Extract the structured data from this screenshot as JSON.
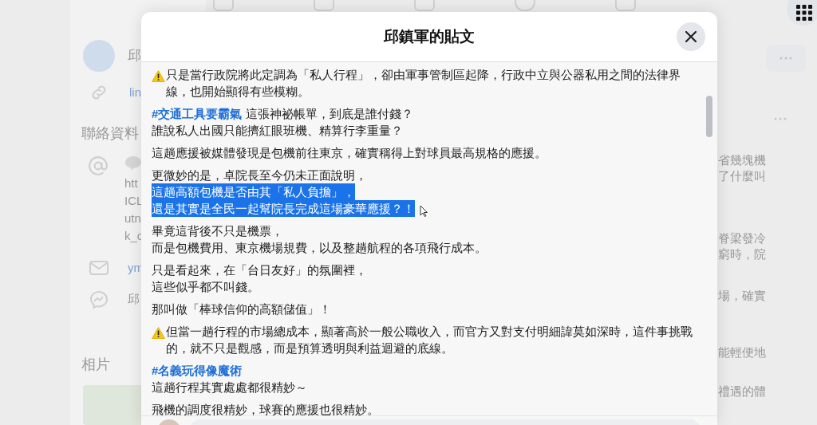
{
  "background": {
    "profile_name": "邱",
    "link": "lin",
    "contact_heading": "聯絡資料",
    "contact_lines": [
      "htt",
      "ICL",
      "utn",
      "k_c"
    ],
    "email": "ym",
    "messenger": "邱",
    "photos_heading": "相片",
    "side_fragments": [
      [
        "省幾塊機",
        "了什麼叫"
      ],
      [
        "脊梁發冷",
        "窮時，院"
      ],
      [
        "場，確實"
      ],
      [
        "能輕便地"
      ],
      [
        "禮遇的體"
      ]
    ]
  },
  "modal": {
    "title": "邱鎮軍的貼文",
    "paragraphs": [
      {
        "warning": true,
        "lines": [
          {
            "text": "只是當行政院將此定調為「私人行程」，卻由軍事管制區起降，行政中立與公器私用之間的法律界線，也開始顯得有些模糊。",
            "selected": false
          }
        ]
      },
      {
        "warning": false,
        "lines": [
          {
            "hashtag": "#交通工具要霸氣",
            "text": "這張神祕帳單，到底是誰付錢？",
            "selected": false
          },
          {
            "text": "誰說私人出國只能擠紅眼班機、精算行李重量？",
            "selected": false
          }
        ]
      },
      {
        "warning": false,
        "lines": [
          {
            "text": "這趟應援被媒體發現是包機前往東京，確實稱得上對球員最高規格的應援。",
            "selected": false
          }
        ]
      },
      {
        "warning": false,
        "lines": [
          {
            "text": "更微妙的是，卓院長至今仍未正面說明，",
            "selected": false
          },
          {
            "text": "這趟高額包機是否由其「私人負擔」，",
            "selected": true
          },
          {
            "text": "還是其實是全民一起幫院長完成這場豪華應援？！",
            "selected": true
          }
        ]
      },
      {
        "warning": false,
        "lines": [
          {
            "text": "畢竟這背後不只是機票，",
            "selected": false
          },
          {
            "text": "而是包機費用、東京機場規費，以及整趟航程的各項飛行成本。",
            "selected": false
          }
        ]
      },
      {
        "warning": false,
        "lines": [
          {
            "text": "只是看起來，在「台日友好」的氛圍裡，",
            "selected": false
          },
          {
            "text": "這些似乎都不叫錢。",
            "selected": false
          }
        ]
      },
      {
        "warning": false,
        "lines": [
          {
            "text": "那叫做「棒球信仰的高額儲值」！",
            "selected": false
          }
        ]
      },
      {
        "warning": true,
        "lines": [
          {
            "text": "但當一趟行程的市場總成本，顯著高於一般公職收入，而官方又對支付明細諱莫如深時，這件事挑戰的，就不只是觀感，而是預算透明與利益迴避的底線。",
            "selected": false
          }
        ]
      },
      {
        "warning": false,
        "lines": [
          {
            "hashtag": "#名義玩得像魔術",
            "selected": false
          },
          {
            "text": "這趟行程其實處處都很精妙～",
            "selected": false
          }
        ]
      },
      {
        "warning": false,
        "lines": [
          {
            "text": "飛機的調度很精妙，球賽的應援也很精妙。",
            "selected": false
          }
        ]
      }
    ]
  }
}
